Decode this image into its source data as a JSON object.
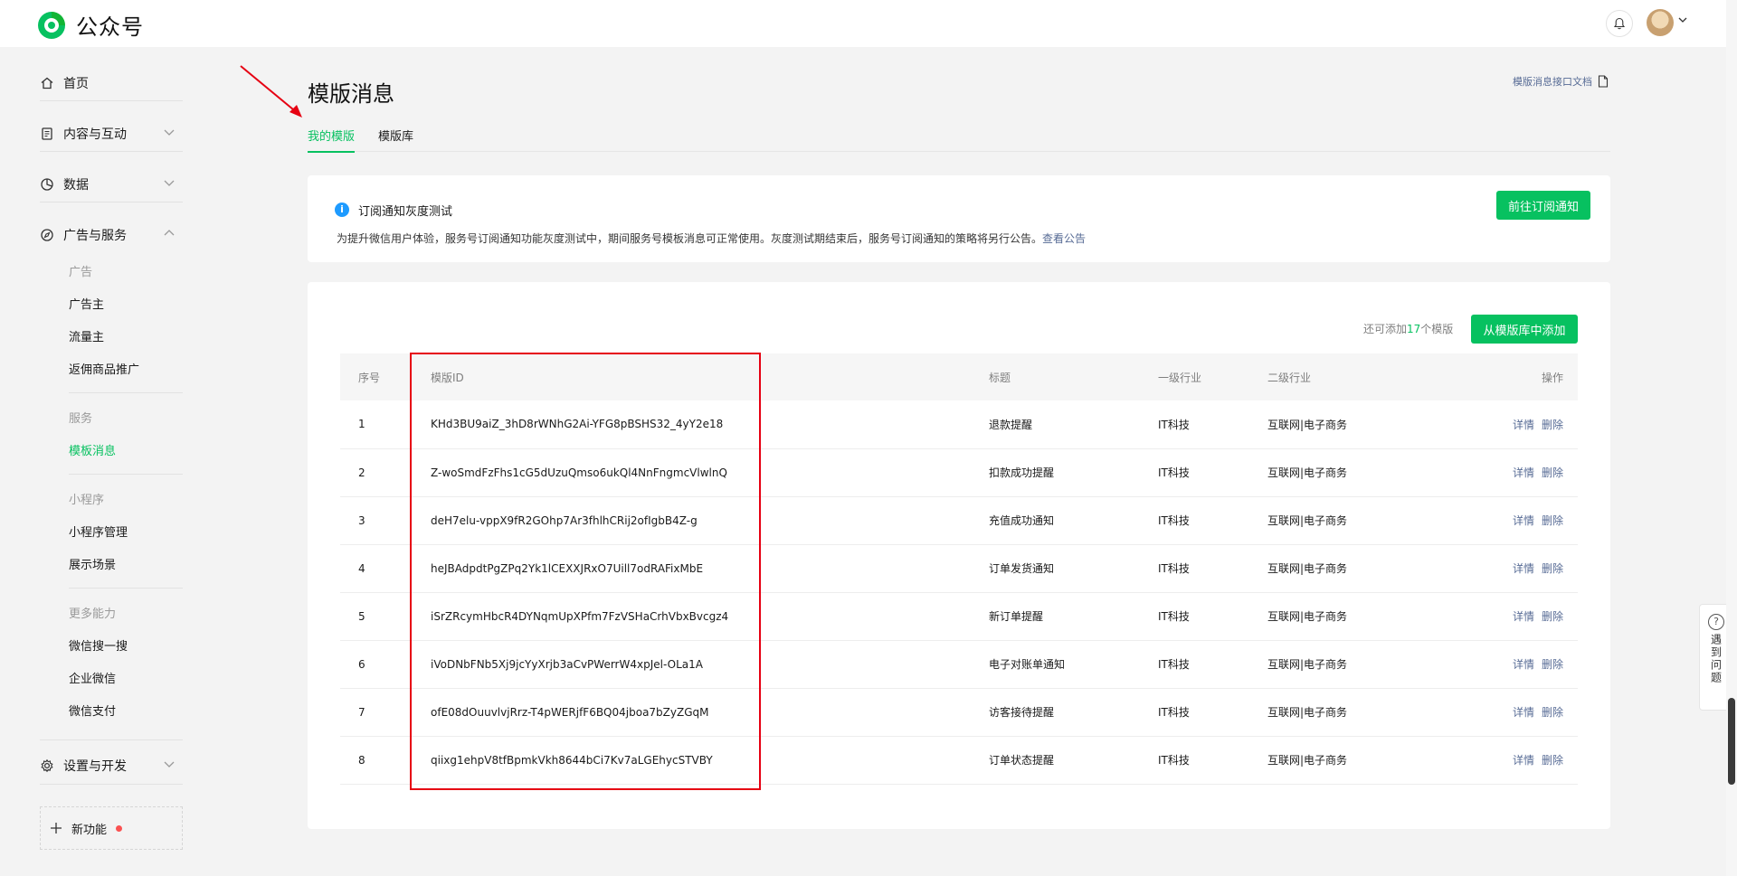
{
  "brand": {
    "title": "公众号",
    "brand_color": "#07c160"
  },
  "header": {
    "bell_icon": "bell-icon",
    "avatar": "user-avatar"
  },
  "sidebar": {
    "items": [
      {
        "label": "首页",
        "icon": "home-icon"
      },
      {
        "label": "内容与互动",
        "icon": "document-icon"
      },
      {
        "label": "数据",
        "icon": "pie-chart-icon"
      },
      {
        "label": "广告与服务",
        "icon": "compass-icon"
      }
    ],
    "groups": {
      "ad": {
        "label": "广告",
        "items": [
          "广告主",
          "流量主",
          "返佣商品推广"
        ]
      },
      "service": {
        "label": "服务",
        "items": [
          "模板消息"
        ]
      },
      "mini": {
        "label": "小程序",
        "items": [
          "小程序管理",
          "展示场景"
        ]
      },
      "more": {
        "label": "更多能力",
        "items": [
          "微信搜一搜",
          "企业微信",
          "微信支付"
        ]
      }
    },
    "settings": {
      "label": "设置与开发",
      "icon": "gear-icon"
    },
    "new_feature": {
      "label": "新功能"
    }
  },
  "page": {
    "title": "模版消息",
    "doc_link": "模版消息接口文档",
    "tabs": [
      "我的模版",
      "模版库"
    ],
    "active_tab": "我的模版"
  },
  "notice": {
    "title": "订阅通知灰度测试",
    "body": "为提升微信用户体验，服务号订阅通知功能灰度测试中，期间服务号模板消息可正常使用。灰度测试期结束后，服务号订阅通知的策略将另行公告。",
    "link": "查看公告",
    "button": "前往订阅通知"
  },
  "templates": {
    "remain_prefix": "还可添加",
    "remain_count": "17",
    "remain_suffix": "个模版",
    "add_button": "从模版库中添加",
    "columns": [
      "序号",
      "模版ID",
      "标题",
      "一级行业",
      "二级行业",
      "操作"
    ],
    "rows": [
      {
        "no": "1",
        "id": "KHd3BU9aiZ_3hD8rWNhG2Ai-YFG8pBSHS32_4yY2e18",
        "title": "退款提醒",
        "ind1": "IT科技",
        "ind2": "互联网|电子商务"
      },
      {
        "no": "2",
        "id": "Z-woSmdFzFhs1cG5dUzuQmso6ukQl4NnFngmcVlwlnQ",
        "title": "扣款成功提醒",
        "ind1": "IT科技",
        "ind2": "互联网|电子商务"
      },
      {
        "no": "3",
        "id": "deH7elu-vppX9fR2GOhp7Ar3fhlhCRij2ofIgbB4Z-g",
        "title": "充值成功通知",
        "ind1": "IT科技",
        "ind2": "互联网|电子商务"
      },
      {
        "no": "4",
        "id": "heJBAdpdtPgZPq2Yk1lCEXXJRxO7Uill7odRAFixMbE",
        "title": "订单发货通知",
        "ind1": "IT科技",
        "ind2": "互联网|电子商务"
      },
      {
        "no": "5",
        "id": "iSrZRcymHbcR4DYNqmUpXPfm7FzVSHaCrhVbxBvcgz4",
        "title": "新订单提醒",
        "ind1": "IT科技",
        "ind2": "互联网|电子商务"
      },
      {
        "no": "6",
        "id": "iVoDNbFNb5Xj9jcYyXrjb3aCvPWerrW4xpJel-OLa1A",
        "title": "电子对账单通知",
        "ind1": "IT科技",
        "ind2": "互联网|电子商务"
      },
      {
        "no": "7",
        "id": "ofE08dOuuvlvjRrz-T4pWERjfF6BQ04jboa7bZyZGqM",
        "title": "访客接待提醒",
        "ind1": "IT科技",
        "ind2": "互联网|电子商务"
      },
      {
        "no": "8",
        "id": "qiixg1ehpV8tfBpmkVkh8644bCi7Kv7aLGEhycSTVBY",
        "title": "订单状态提醒",
        "ind1": "IT科技",
        "ind2": "互联网|电子商务"
      }
    ],
    "op_detail": "详情",
    "op_delete": "删除"
  },
  "help": {
    "label": "遇到问题"
  }
}
